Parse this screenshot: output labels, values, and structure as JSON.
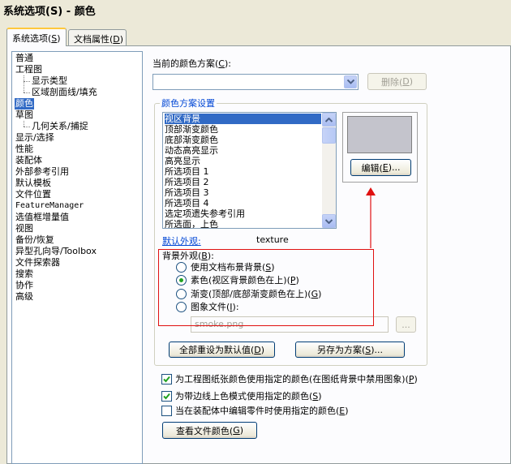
{
  "window": {
    "title": "系统选项(S) - 颜色"
  },
  "tabs": [
    {
      "label": "系统选项",
      "mnemonic": "S"
    },
    {
      "label": "文档属性",
      "mnemonic": "D"
    }
  ],
  "tree": {
    "items": [
      "普通",
      "工程图",
      "显示类型",
      "区域剖面线/填充",
      "颜色",
      "草图",
      "几何关系/捕捉",
      "显示/选择",
      "性能",
      "装配体",
      "外部参考引用",
      "默认模板",
      "文件位置",
      "FeatureManager",
      "选值框增量值",
      "视图",
      "备份/恢复",
      "异型孔向导/Toolbox",
      "文件探索器",
      "搜索",
      "协作",
      "高级"
    ],
    "selected": "颜色"
  },
  "scheme": {
    "label": "当前的颜色方案(",
    "mnemonic": "C",
    "label_end": "):",
    "current_value": "",
    "delete_button": "删除(",
    "delete_mnemonic": "D",
    "delete_end": ")"
  },
  "settings": {
    "group_title": "颜色方案设置",
    "items": [
      "视区背景",
      "顶部渐变颜色",
      "底部渐变颜色",
      "动态高亮显示",
      "高亮显示",
      "所选项目 1",
      "所选项目 2",
      "所选项目 3",
      "所选项目 4",
      "选定项遗失参考引用",
      "所选面，上色"
    ],
    "selected_item": "视区背景",
    "edit_button": "编辑(",
    "edit_mnemonic": "E",
    "edit_end": ")...",
    "swatch_color": "#c4c4cc",
    "default_appearance_label": "默认外观:",
    "default_appearance_value": "texture"
  },
  "background": {
    "group_title": "背景外观(",
    "group_mnemonic": "B",
    "group_end": "):",
    "options": [
      {
        "label": "使用文档布景背景(",
        "mnemonic": "S",
        "end": ")",
        "selected": false
      },
      {
        "label": "素色(视区背景颜色在上)(",
        "mnemonic": "P",
        "end": ")",
        "selected": true
      },
      {
        "label": "渐变(顶部/底部渐变颜色在上)(",
        "mnemonic": "G",
        "end": ")",
        "selected": false
      },
      {
        "label": "图象文件(",
        "mnemonic": "I",
        "end": "):",
        "selected": false
      }
    ],
    "image_file_value": "smoke.png",
    "browse_button": "..."
  },
  "actions": {
    "reset_label": "全部重设为默认值(",
    "reset_mnemonic": "D",
    "reset_end": ")",
    "save_label": "另存为方案(",
    "save_mnemonic": "S",
    "save_end": ")..."
  },
  "checkboxes": [
    {
      "label": "为工程图纸张颜色使用指定的颜色(在图纸背景中禁用图象)(",
      "mnemonic": "P",
      "end": ")",
      "checked": true
    },
    {
      "label": "为带边线上色模式使用指定的颜色(",
      "mnemonic": "S",
      "end": ")",
      "checked": true
    },
    {
      "label": "当在装配体中编辑零件时使用指定的颜色(",
      "mnemonic": "E",
      "end": ")",
      "checked": false
    }
  ],
  "view_file_colors": {
    "label": "查看文件颜色(",
    "mnemonic": "G",
    "end": ")"
  },
  "colors": {
    "selection": "#316ac5",
    "annotation_red": "#e01010",
    "link_blue": "#0046d5"
  }
}
